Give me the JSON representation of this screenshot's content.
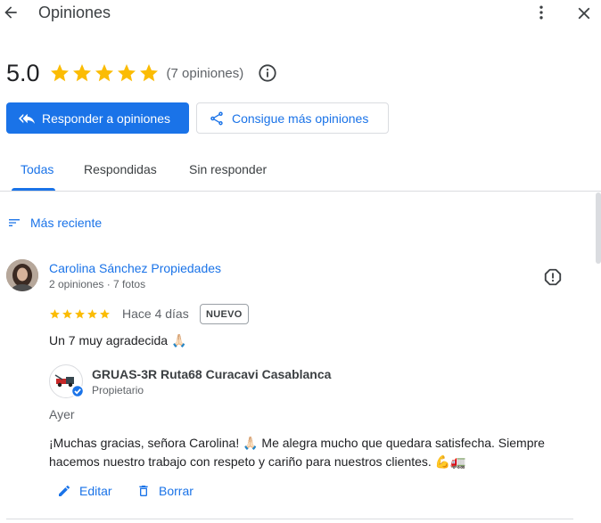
{
  "header": {
    "title": "Opiniones"
  },
  "summary": {
    "rating": "5.0",
    "stars": 5,
    "count_text": "(7 opiniones)"
  },
  "actions": {
    "respond_label": "Responder a opiniones",
    "get_more_label": "Consigue más opiniones"
  },
  "tabs": [
    {
      "label": "Todas",
      "active": true
    },
    {
      "label": "Respondidas",
      "active": false
    },
    {
      "label": "Sin responder",
      "active": false
    }
  ],
  "sort": {
    "label": "Más reciente"
  },
  "review": {
    "author": "Carolina Sánchez Propiedades",
    "meta": "2 opiniones · 7 fotos",
    "stars": 5,
    "time": "Hace 4 días",
    "badge": "NUEVO",
    "text": "Un 7 muy agradecida 🙏🏻"
  },
  "reply": {
    "owner": "GRUAS-3R Ruta68 Curacavi Casablanca",
    "role": "Propietario",
    "time": "Ayer",
    "text": "¡Muchas gracias, señora Carolina! 🙏🏻 Me alegra mucho que quedara satisfecha. Siempre hacemos nuestro trabajo con respeto y cariño para nuestros clientes. 💪🚛",
    "edit_label": "Editar",
    "delete_label": "Borrar"
  },
  "colors": {
    "accent": "#1a73e8",
    "star": "#fbbc04",
    "text": "#202124",
    "muted": "#5f6368",
    "divider": "#dadce0"
  }
}
